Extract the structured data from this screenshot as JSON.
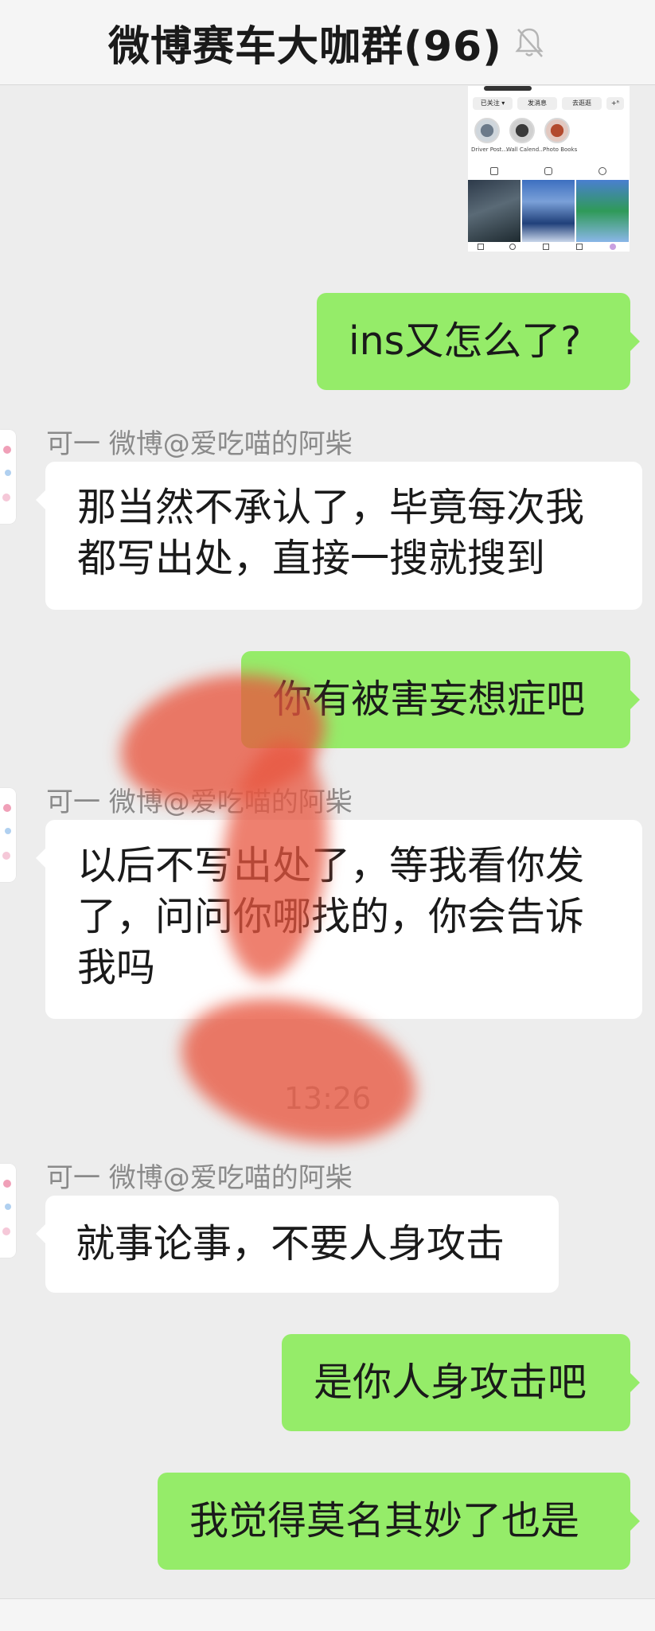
{
  "header": {
    "title": "微博赛车大咖群(96)",
    "icon": "bell-muted-icon"
  },
  "shared_screenshot": {
    "buttons": [
      "已关注 ▾",
      "发消息",
      "去逛逛",
      "+ᴿ"
    ],
    "highlights": [
      "Driver Post...",
      "Wall Calend...",
      "Photo Books"
    ]
  },
  "messages": {
    "m1": {
      "text": "ins又怎么了?"
    },
    "m2": {
      "sender": "可一 微博@爱吃喵的阿柴",
      "text": "那当然不承认了，毕竟每次我都写出处，直接一搜就搜到"
    },
    "m3": {
      "text": "你有被害妄想症吧"
    },
    "m4": {
      "sender": "可一 微博@爱吃喵的阿柴",
      "text": "以后不写出处了，等我看你发了，问问你哪找的，你会告诉我吗"
    },
    "time": "13:26",
    "m5": {
      "sender": "可一 微博@爱吃喵的阿柴",
      "text": "就事论事，不要人身攻击"
    },
    "m6": {
      "text": "是你人身攻击吧"
    },
    "m7": {
      "text": "我觉得莫名其妙了也是"
    }
  },
  "colors": {
    "outgoing_bubble": "#95ec69",
    "incoming_bubble": "#ffffff",
    "background": "#ededed",
    "smear": "#e8563f"
  }
}
